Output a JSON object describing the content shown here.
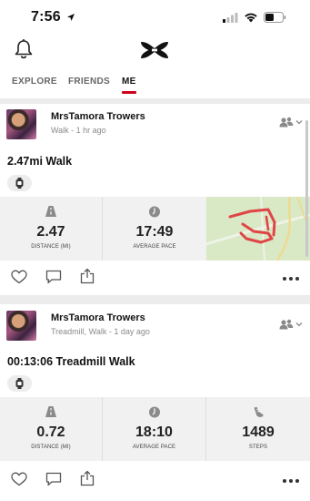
{
  "status_bar": {
    "time": "7:56"
  },
  "tabs": [
    {
      "label": "EXPLORE",
      "active": false
    },
    {
      "label": "FRIENDS",
      "active": false
    },
    {
      "label": "ME",
      "active": true
    }
  ],
  "posts": [
    {
      "user_name": "MrsTamora Trowers",
      "subtitle": "Walk - 1 hr ago",
      "title": "2.47mi Walk",
      "stats": [
        {
          "icon": "road-icon",
          "value": "2.47",
          "label": "DISTANCE (MI)"
        },
        {
          "icon": "pace-clock-icon",
          "value": "17:49",
          "label": "AVERAGE PACE"
        }
      ],
      "has_map": true
    },
    {
      "user_name": "MrsTamora Trowers",
      "subtitle": "Treadmill, Walk - 1 day ago",
      "title": "00:13:06 Treadmill Walk",
      "stats": [
        {
          "icon": "road-icon",
          "value": "0.72",
          "label": "DISTANCE (MI)"
        },
        {
          "icon": "pace-clock-icon",
          "value": "18:10",
          "label": "AVERAGE PACE"
        },
        {
          "icon": "shoe-steps-icon",
          "value": "1489",
          "label": "STEPS"
        }
      ],
      "has_map": false
    }
  ],
  "colors": {
    "accent": "#d0021b",
    "stat_bg": "#f1f1f1",
    "map_bg": "#d8e7c4",
    "route": "#e04545"
  }
}
